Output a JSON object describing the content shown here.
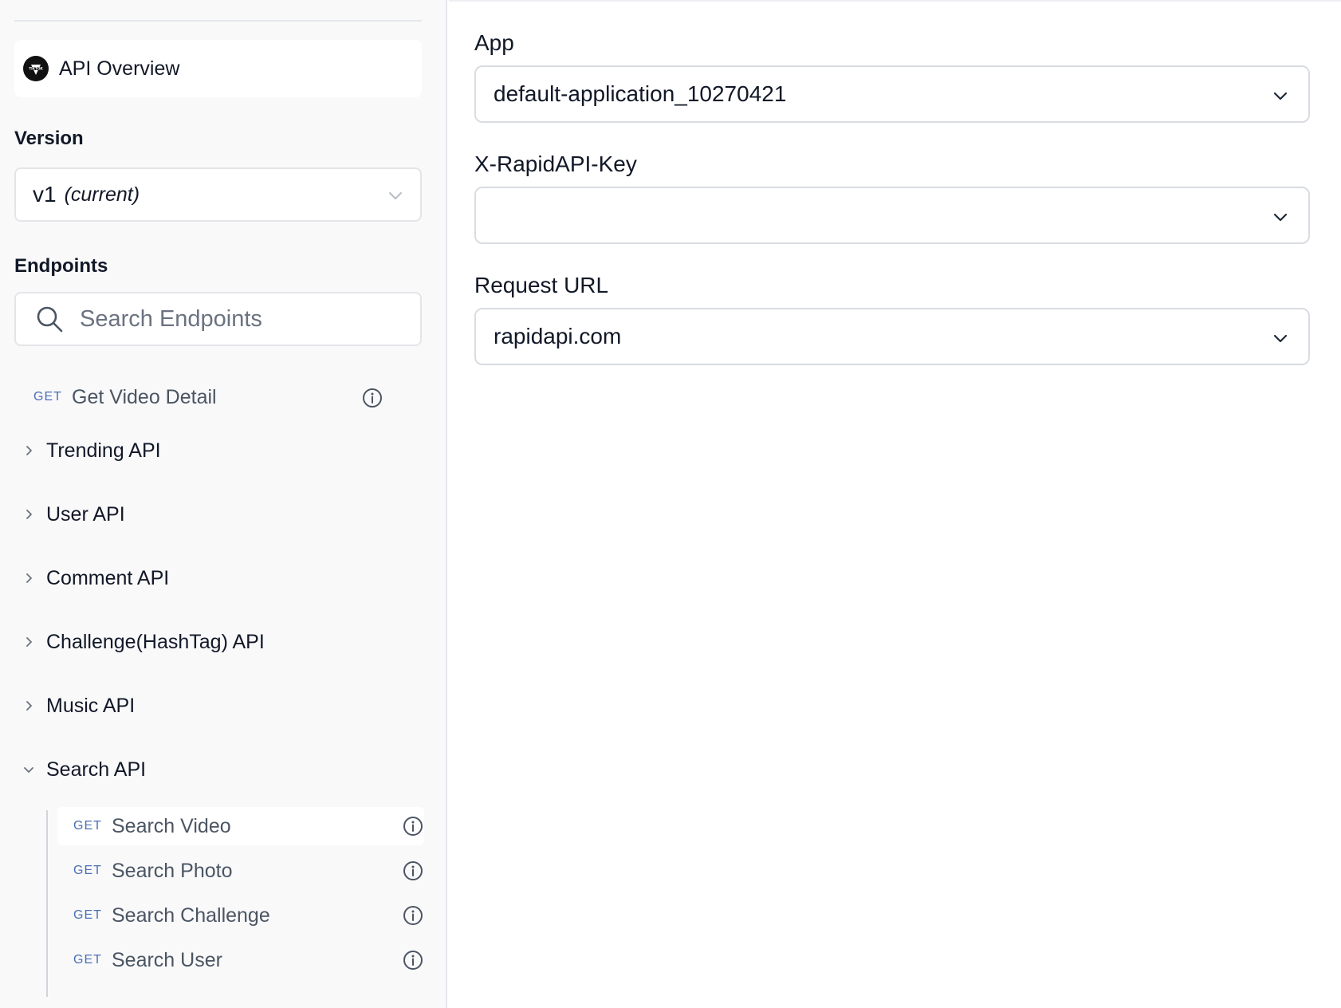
{
  "sidebar": {
    "overview": {
      "label": "API Overview",
      "icon": "tiktok-logo-icon"
    },
    "version": {
      "heading": "Version",
      "value": "v1",
      "note": "(current)"
    },
    "endpoints": {
      "heading": "Endpoints",
      "search_placeholder": "Search Endpoints"
    },
    "top_endpoint": {
      "method": "GET",
      "name": "Get Video Detail"
    },
    "groups": [
      {
        "label": "Trending API",
        "expanded": false
      },
      {
        "label": "User API",
        "expanded": false
      },
      {
        "label": "Comment API",
        "expanded": false
      },
      {
        "label": "Challenge(HashTag) API",
        "expanded": false
      },
      {
        "label": "Music API",
        "expanded": false
      },
      {
        "label": "Search API",
        "expanded": true
      }
    ],
    "search_api_endpoints": [
      {
        "method": "GET",
        "name": "Search Video",
        "active": true
      },
      {
        "method": "GET",
        "name": "Search Photo",
        "active": false
      },
      {
        "method": "GET",
        "name": "Search Challenge",
        "active": false
      },
      {
        "method": "GET",
        "name": "Search User",
        "active": false
      }
    ]
  },
  "main": {
    "app": {
      "label": "App",
      "value": "default-application_10270421"
    },
    "key": {
      "label": "X-RapidAPI-Key",
      "value": ""
    },
    "request_url": {
      "label": "Request URL",
      "value": "rapidapi.com"
    }
  },
  "colors": {
    "method": "#4b6fb5",
    "sidebar_bg": "#f9f9fa",
    "border": "#d9dce1"
  }
}
